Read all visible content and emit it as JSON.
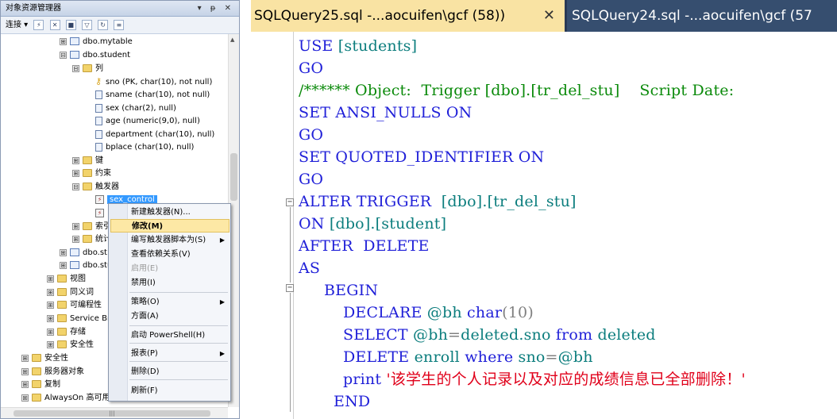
{
  "object_explorer": {
    "title": "对象资源管理器",
    "title_controls": "▾ ᵽ ✕",
    "toolbar": {
      "connect_label": "连接 ▾"
    },
    "tree": [
      {
        "label": "dbo.mytable",
        "icon": "table-icon",
        "expander": "⊞"
      },
      {
        "label": "dbo.student",
        "icon": "table-icon",
        "expander": "⊟"
      },
      {
        "label": "列",
        "icon": "folder-icon",
        "expander": "⊟"
      },
      {
        "label": "sno (PK, char(10), not null)",
        "icon": "key-icon",
        "expander": ""
      },
      {
        "label": "sname (char(10), not null)",
        "icon": "column-icon",
        "expander": ""
      },
      {
        "label": "sex (char(2), null)",
        "icon": "column-icon",
        "expander": ""
      },
      {
        "label": "age (numeric(9,0), null)",
        "icon": "column-icon",
        "expander": ""
      },
      {
        "label": "department (char(10), null)",
        "icon": "column-icon",
        "expander": ""
      },
      {
        "label": "bplace (char(10), null)",
        "icon": "column-icon",
        "expander": ""
      },
      {
        "label": "键",
        "icon": "folder-icon",
        "expander": "⊞"
      },
      {
        "label": "约束",
        "icon": "folder-icon",
        "expander": "⊞"
      },
      {
        "label": "触发器",
        "icon": "folder-icon",
        "expander": "⊟"
      },
      {
        "label": "sex_control",
        "icon": "trigger-icon",
        "expander": ""
      },
      {
        "label": "",
        "icon": "trigger-icon",
        "expander": ""
      },
      {
        "label": "索引",
        "icon": "folder-icon",
        "expander": "⊞"
      },
      {
        "label": "统计",
        "icon": "folder-icon",
        "expander": "⊞"
      },
      {
        "label": "dbo.st",
        "icon": "table-icon",
        "expander": "⊞"
      },
      {
        "label": "dbo.stud",
        "icon": "table-icon",
        "expander": "⊞"
      },
      {
        "label": "视图",
        "icon": "folder-icon",
        "expander": "⊞"
      },
      {
        "label": "同义词",
        "icon": "folder-icon",
        "expander": "⊞"
      },
      {
        "label": "可编程性",
        "icon": "folder-icon",
        "expander": "⊞"
      },
      {
        "label": "Service Br",
        "icon": "folder-icon",
        "expander": "⊞"
      },
      {
        "label": "存储",
        "icon": "folder-icon",
        "expander": "⊞"
      },
      {
        "label": "安全性",
        "icon": "folder-icon",
        "expander": "⊞"
      },
      {
        "label": "安全性",
        "icon": "folder-icon",
        "expander": "⊞"
      },
      {
        "label": "服务器对象",
        "icon": "folder-icon",
        "expander": "⊞"
      },
      {
        "label": "复制",
        "icon": "folder-icon",
        "expander": "⊞"
      },
      {
        "label": "AlwaysOn 高可用性",
        "icon": "folder-icon",
        "expander": "⊞"
      }
    ],
    "hscroll_glyph": "|||"
  },
  "context_menu": {
    "items": [
      {
        "label": "新建触发器(N)...",
        "state": "normal",
        "sub": ""
      },
      {
        "label": "修改(M)",
        "state": "highlight",
        "sub": ""
      },
      {
        "label": "编写触发器脚本为(S)",
        "state": "normal",
        "sub": "▶"
      },
      {
        "label": "查看依赖关系(V)",
        "state": "normal",
        "sub": ""
      },
      {
        "label": "启用(E)",
        "state": "disabled",
        "sub": ""
      },
      {
        "label": "禁用(I)",
        "state": "normal",
        "sub": ""
      },
      {
        "label": "策略(O)",
        "state": "normal",
        "sub": "▶"
      },
      {
        "label": "方面(A)",
        "state": "normal",
        "sub": ""
      },
      {
        "label": "启动 PowerShell(H)",
        "state": "normal",
        "sub": ""
      },
      {
        "label": "报表(P)",
        "state": "normal",
        "sub": "▶"
      },
      {
        "label": "删除(D)",
        "state": "normal",
        "sub": ""
      },
      {
        "label": "刷新(F)",
        "state": "normal",
        "sub": ""
      }
    ]
  },
  "editor": {
    "tabs": [
      {
        "label": "SQLQuery25.sql -...aocuifen\\gcf (58))",
        "close": "✕"
      },
      {
        "label": "SQLQuery24.sql -...aocuifen\\gcf (57"
      }
    ],
    "code": {
      "l1": {
        "kw": "USE ",
        "id": "[students]"
      },
      "l2": {
        "kw": "GO"
      },
      "l3": {
        "cm": "/****** Object:  Trigger [dbo].[tr_del_stu]    Script Date:"
      },
      "l4": {
        "kw": "SET ANSI_NULLS ON"
      },
      "l5": {
        "kw": "GO"
      },
      "l6": {
        "kw": "SET QUOTED_IDENTIFIER ON"
      },
      "l7": {
        "kw": "GO"
      },
      "l8": {
        "kw": "ALTER TRIGGER  ",
        "id": "[dbo].[tr_del_stu]"
      },
      "l9": {
        "kw": "ON ",
        "id": "[dbo].[student]"
      },
      "l10": {
        "kw": "AFTER  DELETE"
      },
      "l11": {
        "kw": "AS"
      },
      "l12": {
        "kw": "BEGIN"
      },
      "l13": {
        "kw": "DECLARE ",
        "id": "@bh ",
        "kw2": "char",
        "gy": "(10)"
      },
      "l14": {
        "kw": "SELECT ",
        "id": "@bh",
        "gy": "=",
        "id2": "deleted.sno ",
        "kw2": "from ",
        "id3": "deleted"
      },
      "l15": {
        "kw": "DELETE ",
        "id": "enroll ",
        "kw2": "where ",
        "id2": "sno",
        "gy": "=",
        "id3": "@bh"
      },
      "l16": {
        "kw": "print ",
        "str": "'该学生的个人记录以及对应的成绩信息已全部删除！'"
      },
      "l17": {
        "kw": "END"
      }
    },
    "fold_collapse": "−"
  }
}
